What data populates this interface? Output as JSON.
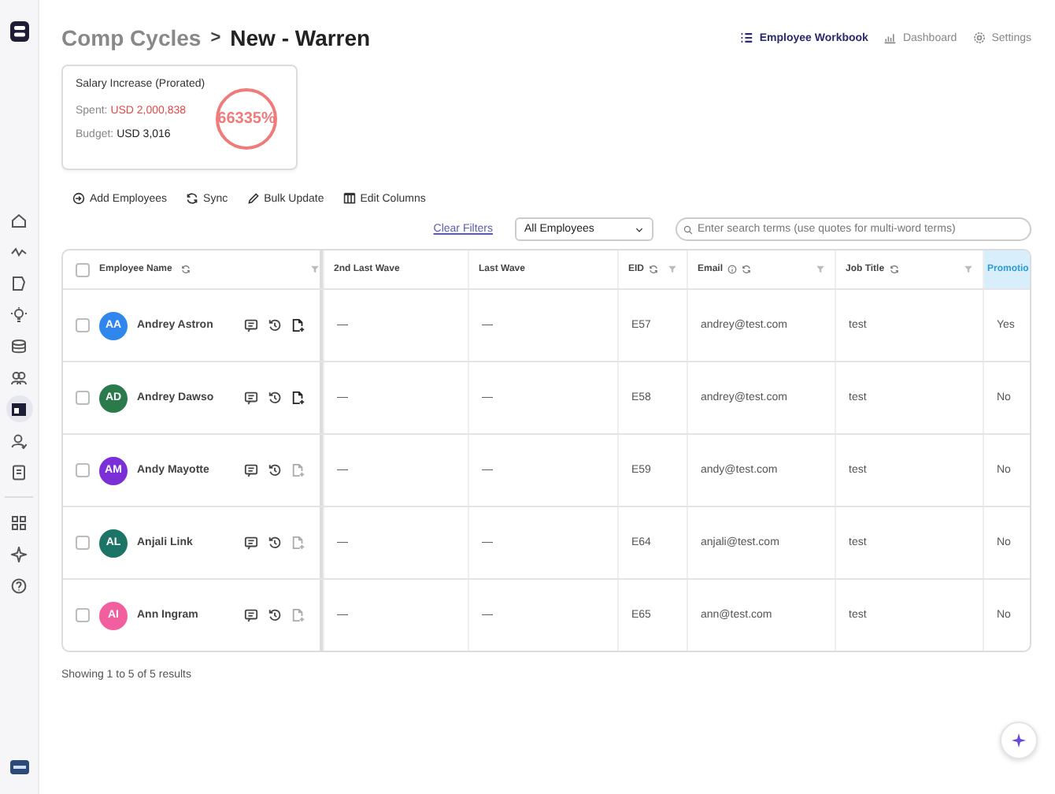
{
  "sidebar": {
    "items": [
      {
        "selected": false
      },
      {
        "selected": false
      },
      {
        "selected": false
      },
      {
        "selected": false
      },
      {
        "selected": false
      },
      {
        "selected": false
      },
      {
        "selected": true
      },
      {
        "selected": false
      },
      {
        "selected": false
      },
      {
        "selected": false
      },
      {
        "selected": false
      },
      {
        "selected": false
      }
    ]
  },
  "breadcrumb": {
    "parent": "Comp Cycles",
    "separator": ">",
    "current": "New - Warren"
  },
  "nav": [
    {
      "label": "Employee Workbook",
      "selected": true
    },
    {
      "label": "Dashboard",
      "selected": false
    },
    {
      "label": "Settings",
      "selected": false
    }
  ],
  "budget_card": {
    "title": "Salary Increase (Prorated)",
    "spent_label": "Spent:",
    "spent": "USD 2,000,838",
    "budget_label": "Budget:",
    "budget": "USD 3,016",
    "percent": "66335%",
    "over_budget": true
  },
  "toolbar": [
    "Add Employees",
    "Sync",
    "Bulk Update",
    "Edit Columns"
  ],
  "filters": {
    "clear": "Clear Filters",
    "dropdown": "All Employees",
    "search_placeholder": "Enter search terms (use quotes for multi-word terms)"
  },
  "table": {
    "columns": [
      {
        "label": "Employee Name",
        "sync": true,
        "info": false,
        "filter": true,
        "highlighted": false
      },
      {
        "label": "2nd Last Wave",
        "sync": false,
        "info": false,
        "filter": false,
        "highlighted": false
      },
      {
        "label": "Last Wave",
        "sync": false,
        "info": false,
        "filter": false,
        "highlighted": false
      },
      {
        "label": "EID",
        "sync": true,
        "info": false,
        "filter": true,
        "highlighted": false
      },
      {
        "label": "Email",
        "sync": true,
        "info": true,
        "filter": true,
        "highlighted": false
      },
      {
        "label": "Job Title",
        "sync": true,
        "info": false,
        "filter": true,
        "highlighted": false
      },
      {
        "label": "Promotio",
        "sync": false,
        "info": false,
        "filter": false,
        "highlighted": true
      }
    ],
    "rows": [
      {
        "checked": false,
        "initials": "AA",
        "color": "#2f86ec",
        "document_active": true,
        "cells": [
          "Andrey Astron",
          "—",
          "—",
          "E57",
          "andrey@test.com",
          "test",
          "Yes"
        ]
      },
      {
        "checked": false,
        "initials": "AD",
        "color": "#2a7a4b",
        "document_active": true,
        "cells": [
          "Andrey Dawso",
          "—",
          "—",
          "E58",
          "andrey@test.com",
          "test",
          "No"
        ]
      },
      {
        "checked": false,
        "initials": "AM",
        "color": "#7b2fd6",
        "document_active": false,
        "cells": [
          "Andy Mayotte",
          "—",
          "—",
          "E59",
          "andy@test.com",
          "test",
          "No"
        ]
      },
      {
        "checked": false,
        "initials": "AL",
        "color": "#1c7466",
        "document_active": false,
        "cells": [
          "Anjali Link",
          "—",
          "—",
          "E64",
          "anjali@test.com",
          "test",
          "No"
        ]
      },
      {
        "checked": false,
        "initials": "AI",
        "color": "#f25f9f",
        "document_active": false,
        "cells": [
          "Ann Ingram",
          "—",
          "—",
          "E65",
          "ann@test.com",
          "test",
          "No"
        ]
      }
    ]
  },
  "footer": "Showing 1 to 5 of 5 results"
}
